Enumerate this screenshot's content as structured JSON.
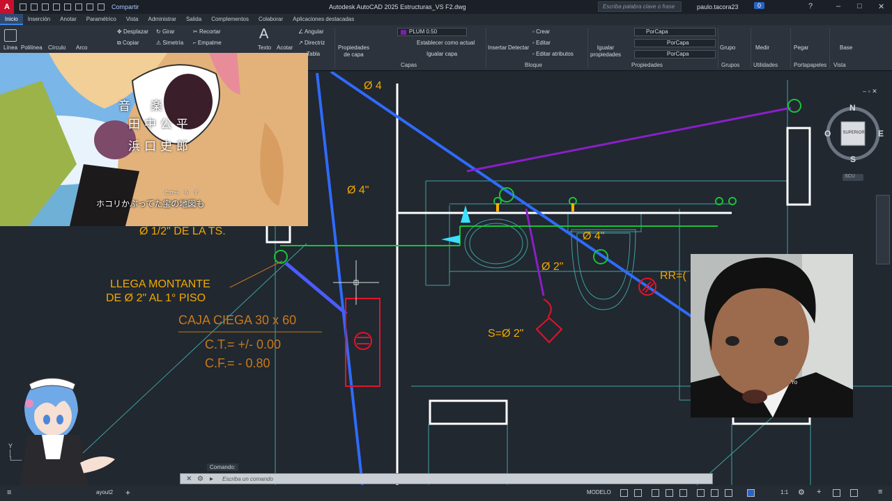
{
  "titlebar": {
    "app_letter": "A",
    "share": "Compartir",
    "title": "Autodesk AutoCAD 2025   Estructuras_VS F2.dwg",
    "search_placeholder": "Escriba palabra clave o frase",
    "user": "paulo.tacora23",
    "badge": "0"
  },
  "tabs": [
    "Inicio",
    "Inserción",
    "Anotar",
    "Paramétrico",
    "Vista",
    "Administrar",
    "Salida",
    "Complementos",
    "Colaborar",
    "Aplicaciones destacadas"
  ],
  "ribbon": {
    "draw": {
      "linea": "Línea",
      "polilinea": "Polilínea",
      "circulo": "Círculo",
      "arco": "Arco"
    },
    "modify": {
      "desplazar": "Desplazar",
      "girar": "Girar",
      "recortar": "Recortar",
      "copiar": "Copiar",
      "simetria": "Simetría",
      "empalme": "Empalme"
    },
    "annotation": {
      "texto": "Texto",
      "acotar": "Acotar",
      "angular": "Angular",
      "directriz": "Directriz",
      "tabla": "Tabla"
    },
    "layers": {
      "prop_capa": "Propiedades de capa",
      "layer_name": "PLUM 0.50",
      "establecer": "Establecer como actual",
      "igualar": "Igualar capa",
      "panel": "Capas"
    },
    "block": {
      "insertar": "Insertar",
      "detectar": "Detectar",
      "crear": "Crear",
      "editar": "Editar",
      "editar_atrib": "Editar atributos",
      "panel": "Bloque"
    },
    "properties": {
      "igualar": "Igualar propiedades",
      "color": "PorCapa",
      "lineweight": "PorCapa",
      "linetype": "PorCapa",
      "panel": "Propiedades"
    },
    "groups": {
      "grupo": "Grupo",
      "panel": "Grupos"
    },
    "utilities": {
      "medir": "Medir",
      "panel": "Utilidades"
    },
    "clipboard": {
      "pegar": "Pegar",
      "panel": "Portapapeles"
    },
    "view": {
      "base": "Base",
      "panel": "Vista"
    }
  },
  "drawing": {
    "labels": {
      "d4_top": "Ø 4",
      "d4_left": "Ø 4\"",
      "d4_mid": "Ø 4\"",
      "d2_mid": "Ø 2\"",
      "d12": "Ø 1/2\" DE LA TS.",
      "montante1": "LLEGA MONTANTE",
      "montante2": "DE Ø 2\" AL 1° PISO",
      "caja": "CAJA CIEGA 30 x 60",
      "ct": "C.T.= +/- 0.00",
      "cf": "C.F.= - 0.80",
      "s": "S=Ø 2\"",
      "rr": "RR=("
    },
    "colors": {
      "blue": "#2f6bff",
      "purple": "#8a1fc7",
      "green": "#19c23a",
      "red": "#e3132a",
      "white": "#ffffff",
      "yellow": "#f2a900",
      "orange": "#c8791a",
      "cyan": "#39e0ff"
    }
  },
  "anime": {
    "col1": "音　楽",
    "col2": "田中公平",
    "col3": "浜口史郎",
    "ruby": "たから　ち　ず",
    "subtitle": "ホコリかぶってた宝の地図も"
  },
  "face_overlay": {
    "watermark": "Yo"
  },
  "navcube": {
    "n": "N",
    "s": "S",
    "e": "E",
    "o": "O",
    "face": "SUPERIOR",
    "ucs": "SCU"
  },
  "command": {
    "label": "Comando:",
    "placeholder": "Escriba un comando"
  },
  "status": {
    "layout": "ayout2",
    "model": "MODELO",
    "scale": "1:1"
  }
}
